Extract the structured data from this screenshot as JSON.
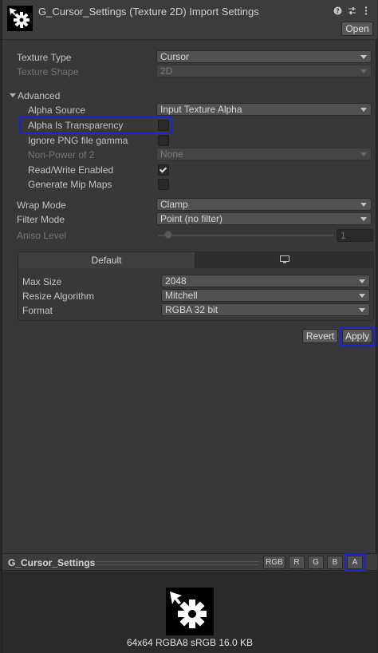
{
  "header": {
    "title": "G_Cursor_Settings (Texture 2D) Import Settings",
    "open_label": "Open",
    "icons": [
      "help-icon",
      "settings-sliders-icon",
      "more-icon"
    ]
  },
  "properties": {
    "texture_type": {
      "label": "Texture Type",
      "value": "Cursor"
    },
    "texture_shape": {
      "label": "Texture Shape",
      "value": "2D"
    },
    "advanced_label": "Advanced",
    "alpha_source": {
      "label": "Alpha Source",
      "value": "Input Texture Alpha"
    },
    "alpha_is_transparency": {
      "label": "Alpha Is Transparency",
      "checked": false
    },
    "ignore_png_gamma": {
      "label": "Ignore PNG file gamma",
      "checked": false
    },
    "non_power_of_2": {
      "label": "Non-Power of 2",
      "value": "None"
    },
    "read_write": {
      "label": "Read/Write Enabled",
      "checked": true
    },
    "generate_mip_maps": {
      "label": "Generate Mip Maps",
      "checked": false
    },
    "wrap_mode": {
      "label": "Wrap Mode",
      "value": "Clamp"
    },
    "filter_mode": {
      "label": "Filter Mode",
      "value": "Point (no filter)"
    },
    "aniso_level": {
      "label": "Aniso Level",
      "value": "1"
    }
  },
  "platform": {
    "tab_default": "Default",
    "max_size": {
      "label": "Max Size",
      "value": "2048"
    },
    "resize_algorithm": {
      "label": "Resize Algorithm",
      "value": "Mitchell"
    },
    "format": {
      "label": "Format",
      "value": "RGBA 32 bit"
    }
  },
  "actions": {
    "revert": "Revert",
    "apply": "Apply"
  },
  "preview": {
    "title": "G_Cursor_Settings",
    "channels": [
      "RGB",
      "R",
      "G",
      "B",
      "A"
    ],
    "info": "64x64  RGBA8 sRGB  16.0 KB"
  },
  "colors": {
    "highlight": "#1c22d6",
    "panel": "#383838"
  }
}
